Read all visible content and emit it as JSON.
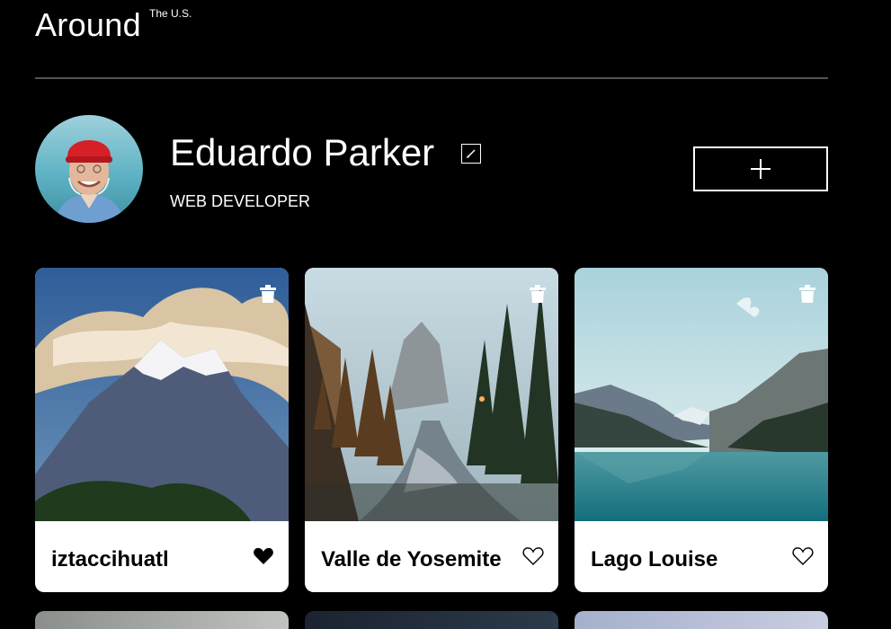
{
  "header": {
    "logo_main": "Around",
    "logo_sup": "The U.S."
  },
  "profile": {
    "name": "Eduardo Parker",
    "job": "WEB DEVELOPER"
  },
  "cards": [
    {
      "title": "iztaccihuatl",
      "liked": true
    },
    {
      "title": "Valle de Yosemite",
      "liked": false
    },
    {
      "title": "Lago Louise",
      "liked": false
    }
  ],
  "icons": {
    "edit": "pencil-icon",
    "add": "plus-icon",
    "delete": "trash-icon",
    "like": "heart-icon"
  },
  "colors": {
    "background": "#000000",
    "card": "#ffffff",
    "divider": "#545454",
    "text": "#ffffff",
    "card_text": "#000000"
  }
}
